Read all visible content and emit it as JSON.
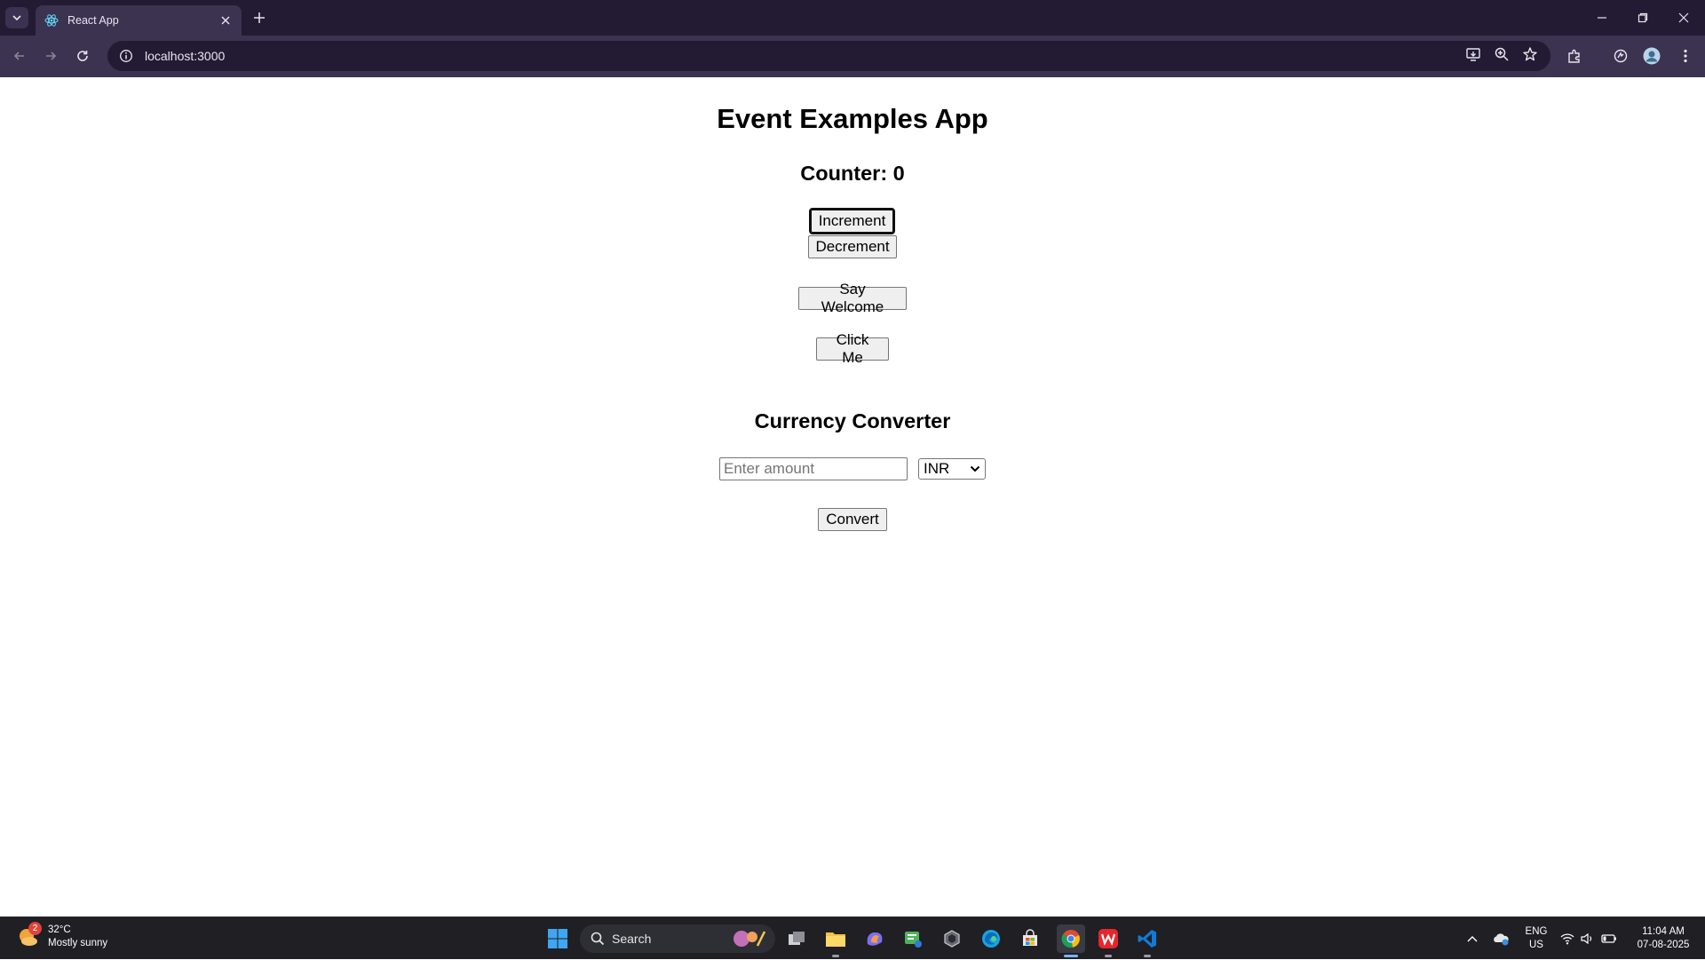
{
  "browser": {
    "tab_title": "React App",
    "url": "localhost:3000"
  },
  "page": {
    "title": "Event Examples App",
    "counter_heading": "Counter: 0",
    "increment_label": "Increment",
    "decrement_label": "Decrement",
    "say_welcome_label": "Say Welcome",
    "click_me_label": "Click Me",
    "converter_heading": "Currency Converter",
    "amount_placeholder": "Enter amount",
    "amount_value": "",
    "currency_selected": "INR",
    "convert_label": "Convert"
  },
  "taskbar": {
    "weather_temp": "32°C",
    "weather_desc": "Mostly sunny",
    "weather_badge": "2",
    "search_label": "Search",
    "lang_top": "ENG",
    "lang_bottom": "US",
    "time": "11:04 AM",
    "date": "07-08-2025"
  }
}
